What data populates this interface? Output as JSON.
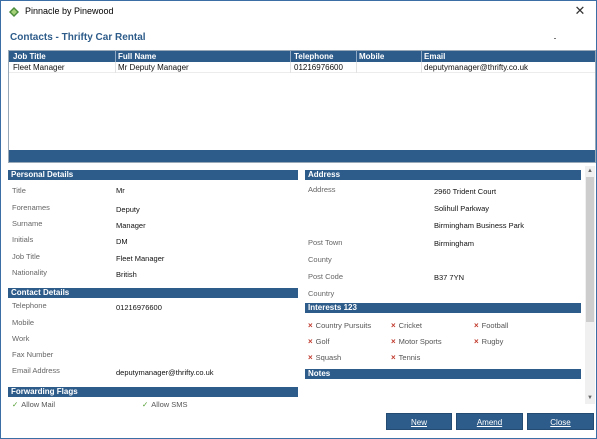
{
  "window": {
    "title": "Pinnacle by Pinewood"
  },
  "heading": "Contacts - Thrifty Car Rental",
  "grid": {
    "columns": [
      "Job Title",
      "Full Name",
      "Telephone",
      "Mobile",
      "Email"
    ],
    "rows": [
      [
        "Fleet Manager",
        "Mr Deputy Manager",
        "01216976600",
        "",
        "deputymanager@thrifty.co.uk"
      ]
    ]
  },
  "personal_details": {
    "header": "Personal Details",
    "fields": [
      {
        "label": "Title",
        "value": "Mr"
      },
      {
        "label": "Forenames",
        "value": "Deputy"
      },
      {
        "label": "Surname",
        "value": "Manager"
      },
      {
        "label": "Initials",
        "value": "DM"
      },
      {
        "label": "Job Title",
        "value": "Fleet Manager"
      },
      {
        "label": "Nationality",
        "value": "British"
      }
    ]
  },
  "contact_details": {
    "header": "Contact Details",
    "fields": [
      {
        "label": "Telephone",
        "value": "01216976600"
      },
      {
        "label": "Mobile",
        "value": ""
      },
      {
        "label": "Work",
        "value": ""
      },
      {
        "label": "Fax Number",
        "value": ""
      },
      {
        "label": "Email Address",
        "value": "deputymanager@thrifty.co.uk"
      }
    ]
  },
  "forwarding_flags": {
    "header": "Forwarding Flags",
    "items": [
      "Allow Mail",
      "Allow SMS"
    ]
  },
  "address": {
    "header": "Address",
    "address_label": "Address",
    "lines": [
      "2960 Trident Court",
      "Solihull Parkway",
      "Birmingham Business Park"
    ],
    "fields": [
      {
        "label": "Post Town",
        "value": "Birmingham"
      },
      {
        "label": "County",
        "value": ""
      },
      {
        "label": "Post Code",
        "value": "B37 7YN"
      },
      {
        "label": "Country",
        "value": ""
      }
    ]
  },
  "interests": {
    "header": "Interests 123",
    "items": [
      "Country Pursuits",
      "Cricket",
      "Football",
      "Golf",
      "Motor Sports",
      "Rugby",
      "Squash",
      "Tennis"
    ]
  },
  "notes": {
    "header": "Notes"
  },
  "buttons": {
    "new": "New",
    "amend": "Amend",
    "close": "Close"
  },
  "icons": {
    "close": "close-icon",
    "interest_state": "x-mark-icon",
    "flag_state": "checkmark-icon"
  },
  "colors": {
    "header_blue": "#2e5c8a",
    "x_red": "#c0392b",
    "check_green": "#4a9a2a"
  }
}
